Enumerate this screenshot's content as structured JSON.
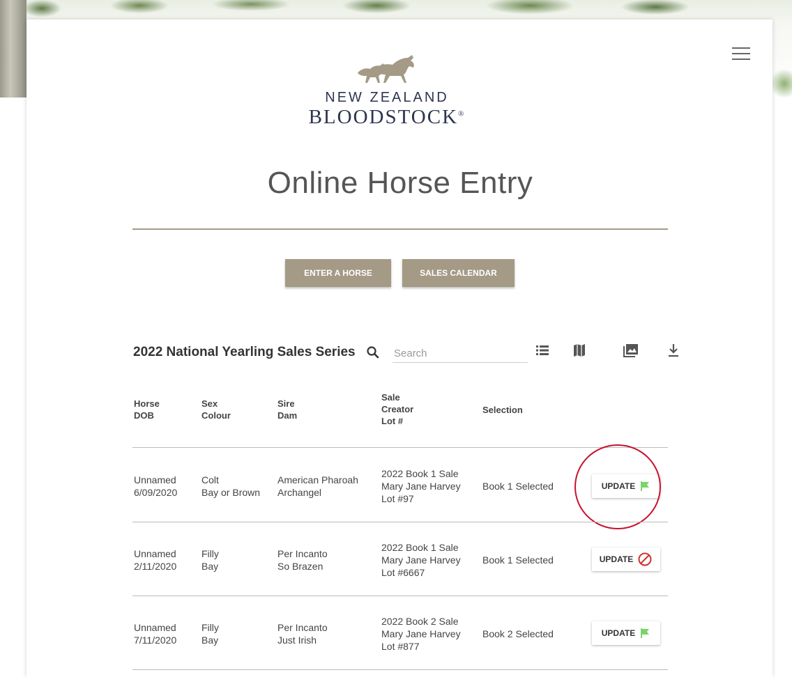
{
  "logo": {
    "line1": "NEW ZEALAND",
    "line2": "BLOODSTOCK",
    "reg": "®"
  },
  "page_title": "Online Horse Entry",
  "buttons": {
    "enter_horse": "ENTER A HORSE",
    "sales_calendar": "SALES CALENDAR"
  },
  "series_title": "2022 National Yearling Sales Series",
  "search": {
    "placeholder": "Search",
    "value": ""
  },
  "columns": {
    "horse": [
      "Horse",
      "DOB"
    ],
    "sex": [
      "Sex",
      "Colour"
    ],
    "sire": [
      "Sire",
      "Dam"
    ],
    "sale": [
      "Sale",
      "Creator",
      "Lot #"
    ],
    "selection": [
      "Selection"
    ]
  },
  "rows": [
    {
      "horse": "Unnamed",
      "dob": "6/09/2020",
      "sex": "Colt",
      "colour": "Bay or Brown",
      "sire": "American Pharoah",
      "dam": "Archangel",
      "sale": "2022 Book 1 Sale",
      "creator": "Mary Jane Harvey",
      "lot": "Lot #97",
      "selection": "Book 1 Selected",
      "update_label": "UPDATE",
      "status_icon": "flag-icon"
    },
    {
      "horse": "Unnamed",
      "dob": "2/11/2020",
      "sex": "Filly",
      "colour": "Bay",
      "sire": "Per Incanto",
      "dam": "So Brazen",
      "sale": "2022 Book 1 Sale",
      "creator": "Mary Jane Harvey",
      "lot": "Lot #6667",
      "selection": "Book 1 Selected",
      "update_label": "UPDATE",
      "status_icon": "blocked-icon"
    },
    {
      "horse": "Unnamed",
      "dob": "7/11/2020",
      "sex": "Filly",
      "colour": "Bay",
      "sire": "Per Incanto",
      "dam": "Just Irish",
      "sale": "2022 Book 2 Sale",
      "creator": "Mary Jane Harvey",
      "lot": "Lot #877",
      "selection": "Book 2 Selected",
      "update_label": "UPDATE",
      "status_icon": "flag-icon"
    }
  ],
  "colors": {
    "accent": "#a49a85",
    "brand_navy": "#2c3550",
    "flag_green": "#7cd36b",
    "blocked_red": "#d0312d",
    "highlight_red": "#c8102e"
  }
}
